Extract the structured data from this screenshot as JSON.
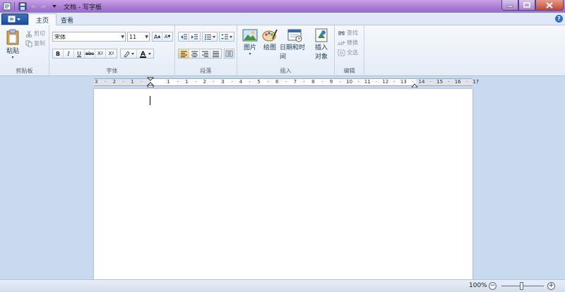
{
  "window": {
    "title": "文档 - 写字板"
  },
  "tabs": [
    {
      "label": "主页"
    },
    {
      "label": "查看"
    }
  ],
  "clipboard": {
    "paste": "粘贴",
    "cut": "剪切",
    "copy": "复制",
    "group": "剪贴板"
  },
  "font": {
    "family": "宋体",
    "size": "11",
    "group": "字体"
  },
  "paragraph": {
    "group": "段落"
  },
  "insert": {
    "picture": "图片",
    "paint": "绘图",
    "datetime": "日期和时间",
    "object_line1": "插入",
    "object_line2": "对象",
    "group": "插入"
  },
  "editing": {
    "find": "查找",
    "replace": "替换",
    "select_all": "全选",
    "group": "编辑"
  },
  "ruler": {
    "marks": [
      "3",
      "2",
      "1",
      "1",
      "1",
      "2",
      "3",
      "4",
      "5",
      "6",
      "7",
      "8",
      "9",
      "10",
      "11",
      "12",
      "13",
      "14",
      "15",
      "16",
      "17"
    ]
  },
  "status": {
    "zoom": "100%",
    "zoom_fraction": 0.5
  },
  "colors": {
    "titlebar": "#a77ad4",
    "ribbon": "#f5f8fc",
    "workspace": "#c9d9ee",
    "accent": "#1d4f9c"
  }
}
